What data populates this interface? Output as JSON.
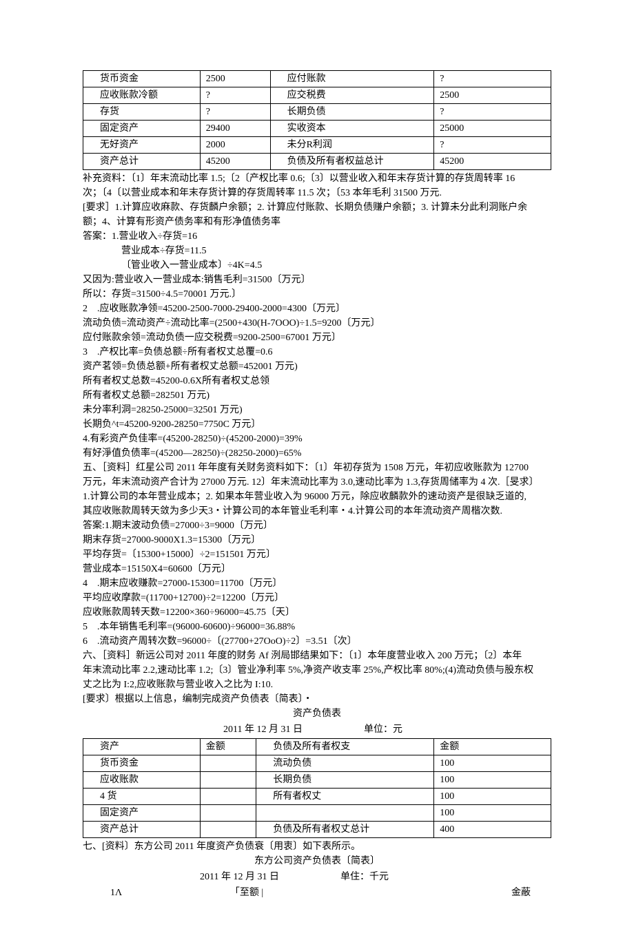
{
  "table1": {
    "rows": [
      [
        "货币资金",
        "2500",
        "应付账款",
        "?"
      ],
      [
        "应收账款冷额",
        "?",
        "应交税费",
        "2500"
      ],
      [
        "存货",
        "?",
        "长期负债",
        "?"
      ],
      [
        "固定资产",
        "29400",
        "实收资本",
        "25000"
      ],
      [
        "无好资产",
        "2000",
        "未分R利润",
        "?"
      ],
      [
        "资产总计",
        "45200",
        "负债及所有者权益总计",
        "45200"
      ]
    ]
  },
  "body1": [
    "补充资料：〔1〕年末流动比率 1.5;〔2〔产权比率 0.6;〔3〕以营业收入和年末存货计算的存货周转率 16",
    "次；〔4〔以营业成本和年末存货计算的存货周转率 11.5 次；〔53 本年毛利 31500 万元.",
    "[要求］1.计算应收麻款、存货麟户余额；2. 计算应付账款、长期负债赚户余额；3. 计算未分此利洞账户余",
    "额；4、计算有形资产债务率和有形净值债务率",
    "答案：1.营业收入÷存货=16"
  ],
  "body1_indent": [
    "营业成本÷存货=11.5",
    "〔管业收入一营业成本〕÷4K=4.5"
  ],
  "body2": [
    "又因为:营业收入一营业成本:销售毛利=31500〔万元〕",
    "所以：存货=31500÷4.5=70001 万元.〕",
    "2　.应收账款净领=45200-2500-7000-29400-2000=4300〔万元〕",
    "流动负债=流动资产÷流动比率=(2500+430(H-7OOO)÷1.5=9200〔万元〕",
    "应付账款余领=流动负债一应交税费=9200-2500=67001 万元〕",
    "3　.产权比率=负债总额÷所有者权丈总覆=0.6",
    "资产茗领=负债总额+所有者权丈总额=452001 万元)",
    "所有者权丈总数=45200-0.6X所有者权丈总领",
    "所有者权丈总额=282501 万元)",
    "未分率利洞=28250-25000=32501 万元)",
    "长期负^t=45200-9200-28250=7750C 万元〕",
    "4.有彩资产负佳率=(45200-28250)÷(45200-2000)=39%",
    "有好淨值负债率=(45200—28250)÷(28250-2000)=65%",
    "五、［资料］红星公司 2011 年年度有关财务资料如下：〔1〕年初存货为 1508 万元，年初应收账款为 12700",
    "万元，年末流动资产合计为 27000 万元. 12〕年末流动比率为 3.0,速动比率为 1.3,存货周储率为 4 次.［旻求〕",
    "1.计算公司的本年营业成本；2. 如果本年营业收入为 96000 万元，除应收麟款外的速动资产是很缺乏道的,",
    "其应收账款周转天敛为多少天3・计算公司的本年管业毛利率・4.计算公司的本年流动资产周楷次数.",
    "答案:1.期末波动负债=27000÷3=9000〔万元〕",
    "期末存货=27000-9000X1.3=15300〔万元〕",
    "平均存货=〔15300+15000〕÷2=151501 万元〕",
    "营业成本=15150X4=60600〔万元〕",
    "4　.期末应收赚款=27000-15300=11700〔万元〕",
    "平均应收摩款=(11700+12700)÷2=12200〔万元〕",
    "应收账款周转天数=12200×360÷96000=45.75〔天〕",
    "5　.本年销售毛利率=(96000-60600)÷96000=36.88%",
    "6　.流动资产周转次数=96000÷〔(27700+27OoO)÷2〕=3.51〔次〕",
    "六、［资料］新远公司对 2011 年度的财务 Af 洌局邯结果如下：〔1〕本年度营业收入 200 万元；〔2〕本年",
    "年末流动比率 2.2,速动比率 1.2;〔3〕管业净利率 5%,净资产收支率 25%,产权比率 80%;(4)流动负债与股东权",
    "丈之比为 I:2,应收账款与营业收入之比为 I:10.",
    "[要求〕根据以上信息，编制完成资产负债表〔简表〕・"
  ],
  "table2_title": "资产负债表",
  "table2_sub": {
    "left": "2011 年 12 月 31 日",
    "right": "单位：元"
  },
  "table2": {
    "rows": [
      [
        "资产",
        "金额",
        "负债及所有者权支",
        "金额"
      ],
      [
        "货币资金",
        "",
        "流动负债",
        "100"
      ],
      [
        "应收账款",
        "",
        "长期负债",
        "100"
      ],
      [
        "4 货",
        "",
        "所有者权丈",
        "100"
      ],
      [
        "固定资产",
        "",
        "",
        "100"
      ],
      [
        "资产总计",
        "",
        "负债及所有者权丈总计",
        "400"
      ]
    ]
  },
  "body3": [
    "七、[资料〕东方公司 2011 年度资产负债衰〔用衷〕如下表所示。"
  ],
  "table3_title": "东方公司资产负债表〔简表〕",
  "table3_sub": {
    "left": "2011 年 12 月 31 日",
    "right": "单住：千元"
  },
  "footer": {
    "left": "1Λ",
    "mid": "「至额 |",
    "right": "金蔽"
  }
}
